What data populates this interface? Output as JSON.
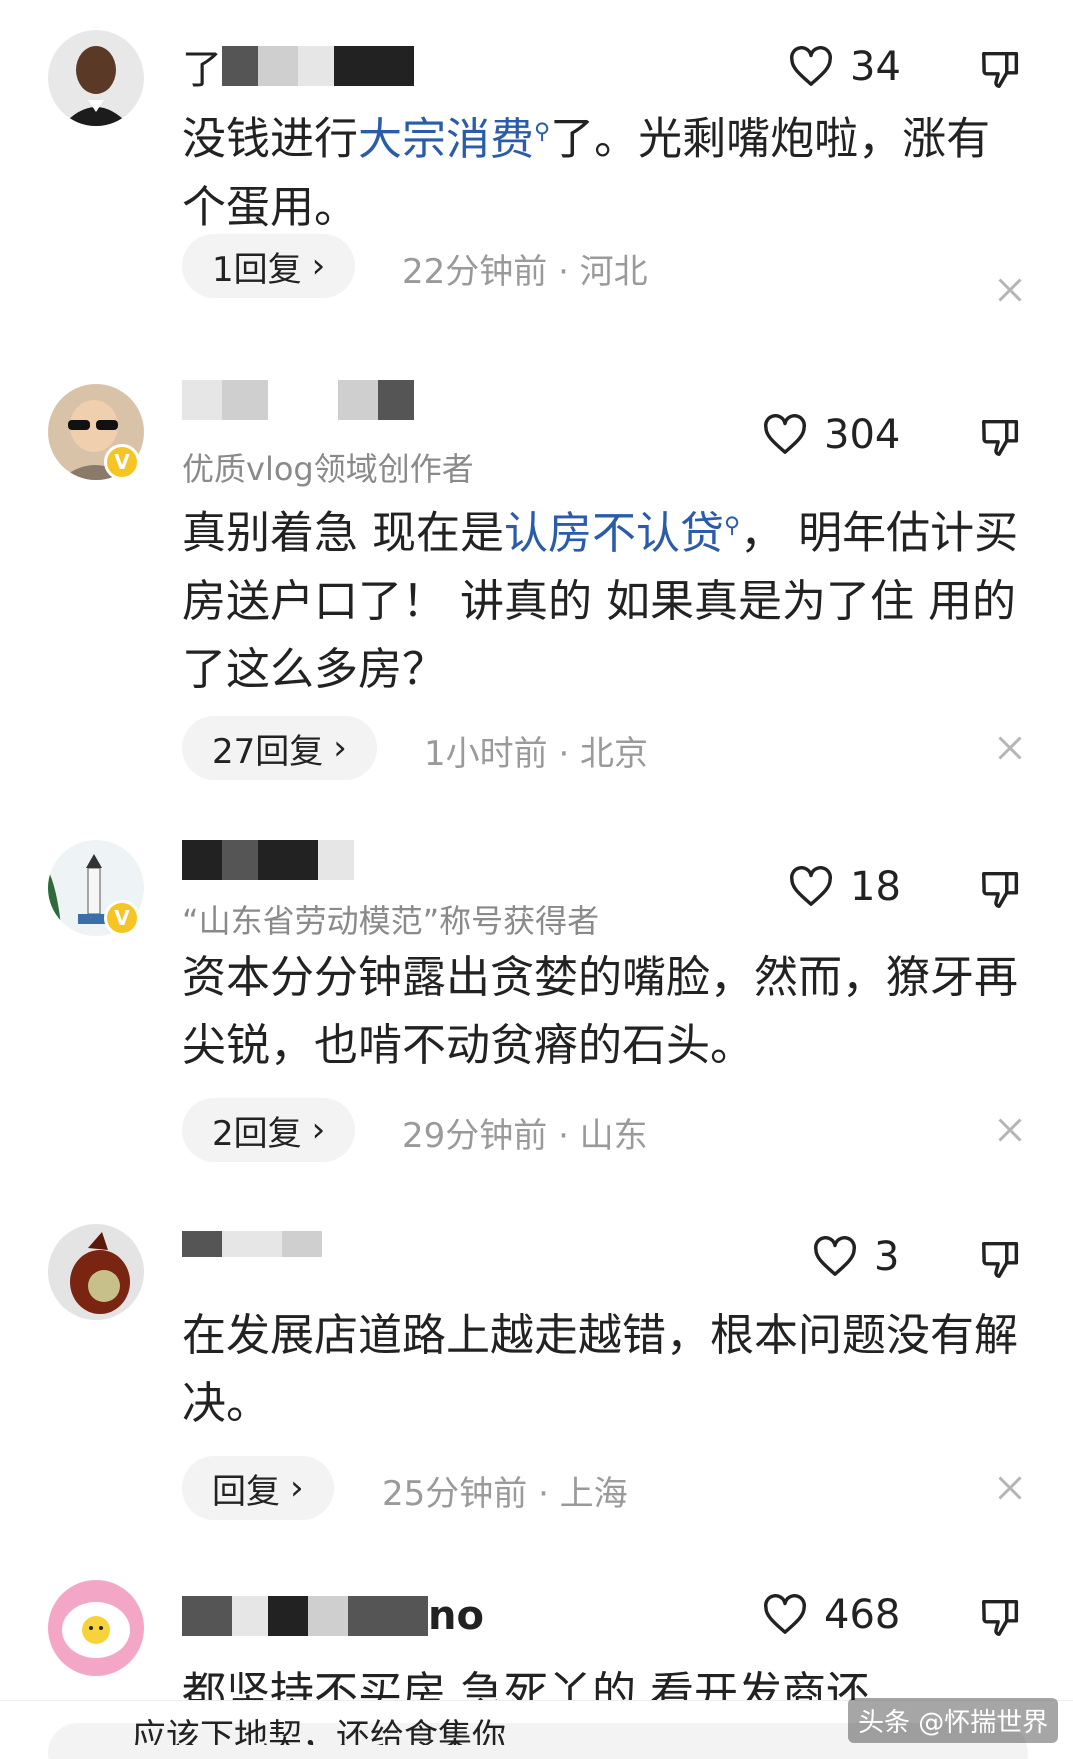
{
  "comments": [
    {
      "username_visible": "了",
      "title": "",
      "likes": "34",
      "body": [
        {
          "t": "没钱进行"
        },
        {
          "t": "大宗消费",
          "kw": true
        },
        {
          "t": "了。光剩嘴炮啦，涨有个蛋用。"
        }
      ],
      "reply_label": "1回复",
      "meta": "22分钟前 · 河北"
    },
    {
      "username_visible": "",
      "title": "优质vlog领域创作者",
      "likes": "304",
      "body": [
        {
          "t": "真别着急 现在是"
        },
        {
          "t": "认房不认贷",
          "kw": true
        },
        {
          "t": "， 明年估计买房送户口了！ 讲真的 如果真是为了住 用的了这么多房？"
        }
      ],
      "reply_label": "27回复",
      "meta": "1小时前 · 北京"
    },
    {
      "username_visible": "",
      "title": "“山东省劳动模范”称号获得者",
      "likes": "18",
      "body": [
        {
          "t": "资本分分钟露出贪婪的嘴脸，然而，獠牙再尖锐，也啃不动贫瘠的石头。"
        }
      ],
      "reply_label": "2回复",
      "meta": "29分钟前 · 山东"
    },
    {
      "username_visible": "",
      "title": "",
      "likes": "3",
      "body": [
        {
          "t": "在发展店道路上越走越错，根本问题没有解决。"
        }
      ],
      "reply_label": "回复",
      "meta": "25分钟前 · 上海"
    },
    {
      "username_visible": "no",
      "title": "",
      "likes": "468",
      "body": [
        {
          "t": "都坚持不买房 急死丫的 看开发商还"
        }
      ],
      "reply_label": "",
      "meta": ""
    }
  ],
  "bottom": {
    "input_text": "应该下地契，还给食集你",
    "watermark": "头条 @怀揣世界"
  },
  "icons": {
    "like": "heart-outline-icon",
    "dislike": "thumbs-down-icon",
    "chevron": "chevron-right-icon",
    "close": "close-icon",
    "verified": "verified-v-badge-icon"
  },
  "colors": {
    "keyword_link": "#2a5caa",
    "verified_badge": "#f6c423",
    "meta_gray": "#9a9a9a"
  }
}
